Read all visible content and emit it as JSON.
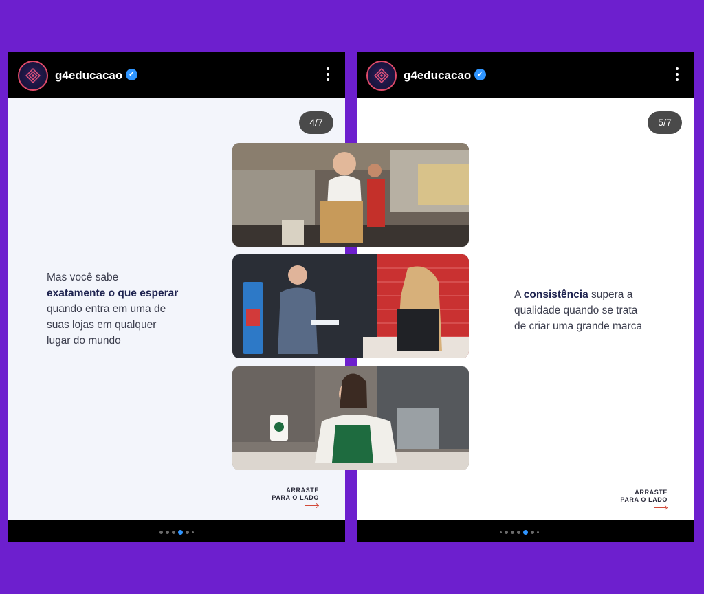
{
  "account": {
    "username": "g4educacao",
    "verified": true
  },
  "slides": [
    {
      "counter": "4/7",
      "caption_pre": "Mas você sabe",
      "caption_bold": "exatamente o que esperar",
      "caption_rest": [
        "quando entra em uma de",
        "suas lojas em qualquer",
        "lugar do mundo"
      ]
    },
    {
      "counter": "5/7",
      "caption_pre": "A",
      "caption_bold": "consistência",
      "caption_post": "supera a",
      "caption_rest": [
        "qualidade quando se trata",
        "de criar uma grande marca"
      ]
    }
  ],
  "swipe": {
    "line1": "ARRASTE",
    "line2": "PARA O LADO"
  },
  "icons": {
    "menu": "more-vertical-icon",
    "verified": "verified-badge-icon",
    "avatar": "brand-logo-icon"
  },
  "photos": [
    {
      "name": "mcdonalds-counter-photo"
    },
    {
      "name": "dominos-pickup-photo"
    },
    {
      "name": "starbucks-barista-photo"
    }
  ],
  "pagination": {
    "left_active_index": 3,
    "right_active_index": 4,
    "total": 6
  },
  "colors": {
    "background": "#6d1fce",
    "accent": "#2f95ff",
    "text_bold": "#1f2450"
  }
}
